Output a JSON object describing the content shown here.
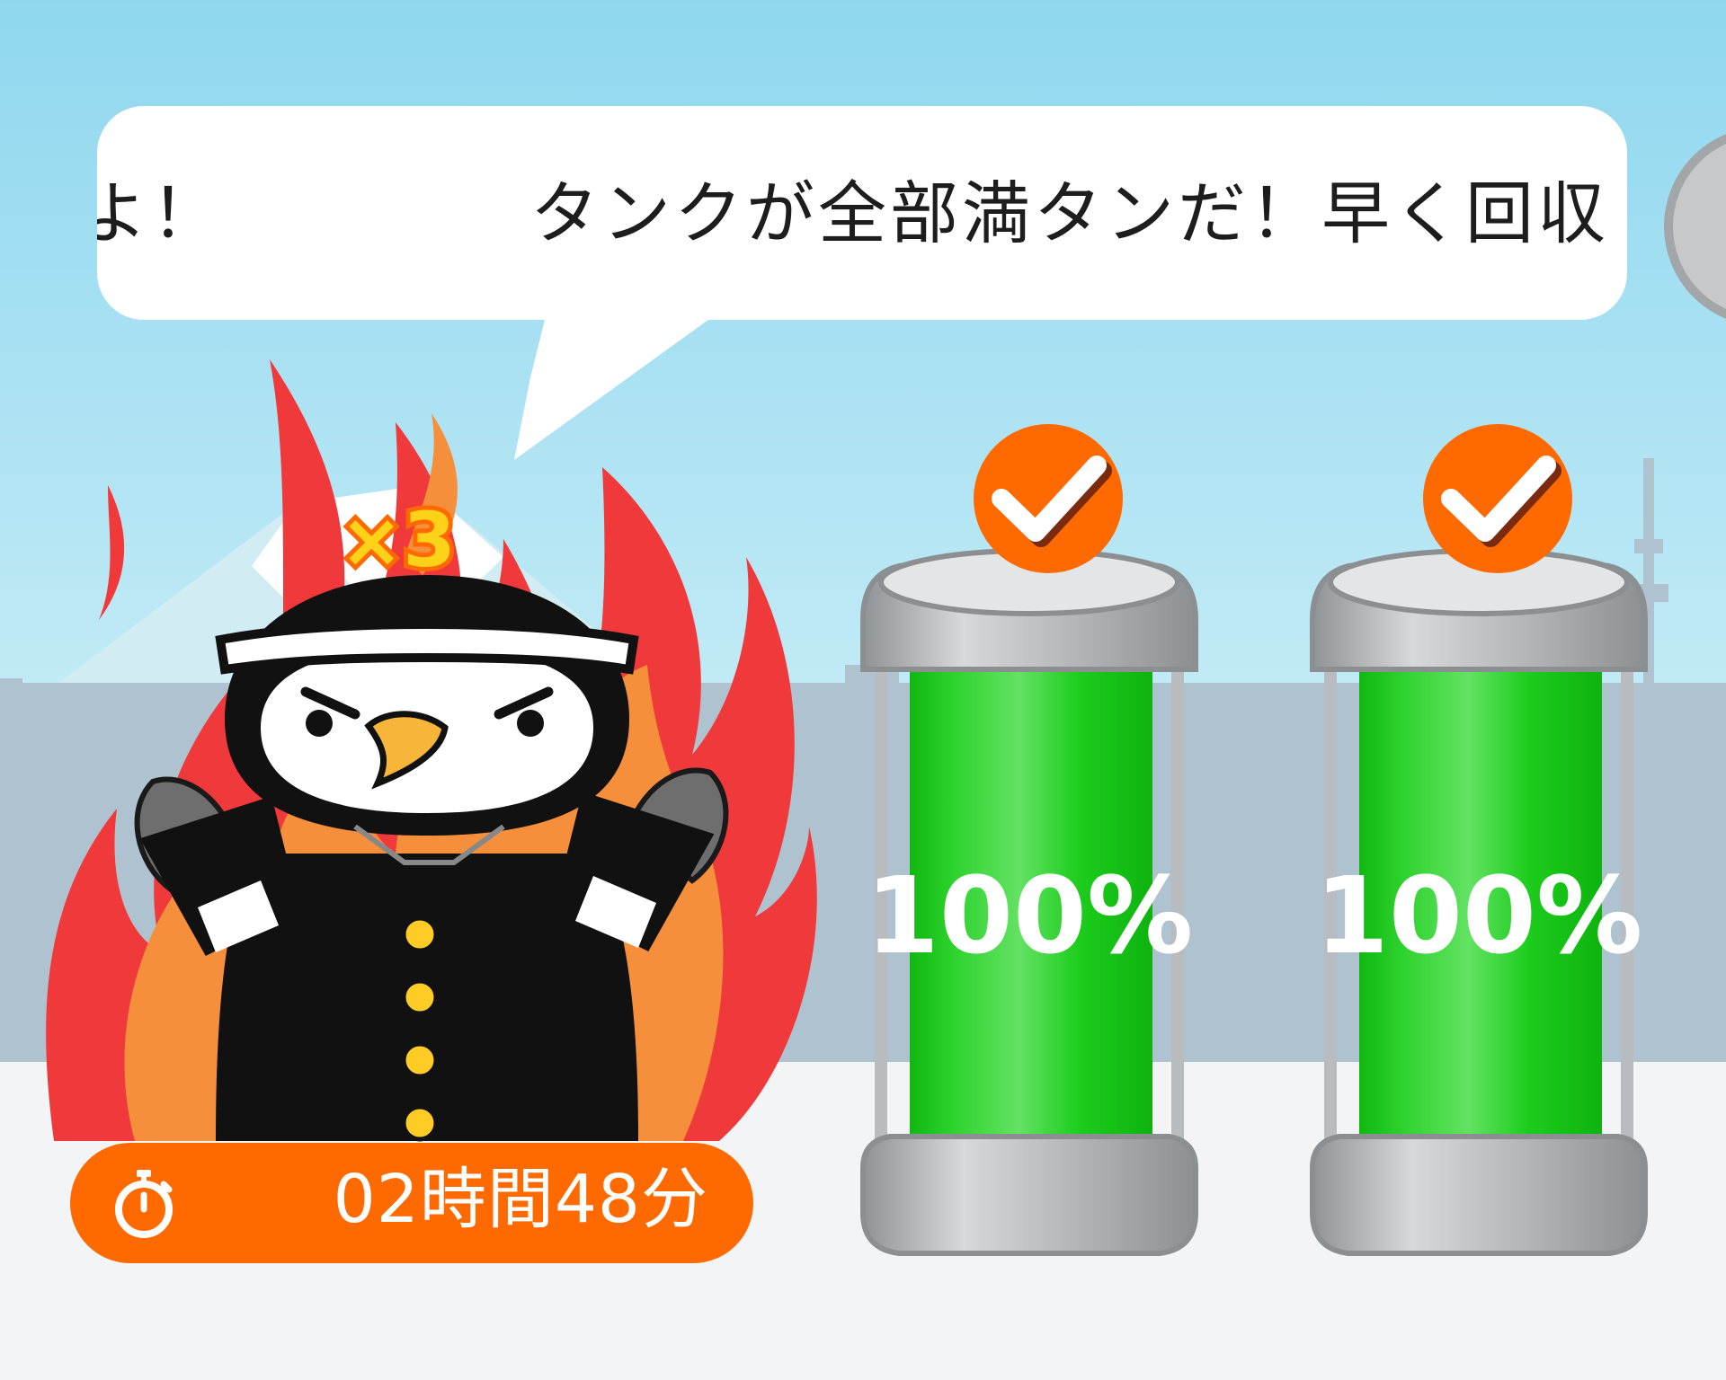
{
  "speech_bubble": {
    "message_main": "タンクが全部満タンだ！早く回収",
    "message_tail": "よ！"
  },
  "character": {
    "multiplier_badge": "×3"
  },
  "timer": {
    "icon": "stopwatch-icon",
    "remaining": "02時間48分"
  },
  "tanks": [
    {
      "fill_percent": 100,
      "label": "100%",
      "status_icon": "check-icon"
    },
    {
      "fill_percent": 100,
      "label": "100%",
      "status_icon": "check-icon"
    }
  ],
  "colors": {
    "sky_top": "#8fd7ef",
    "accent_orange": "#ff6a00",
    "tank_green": "#12c712",
    "tank_glass": "#c9ccce",
    "fire_red": "#f0393b",
    "fire_orange": "#f58f3c"
  }
}
